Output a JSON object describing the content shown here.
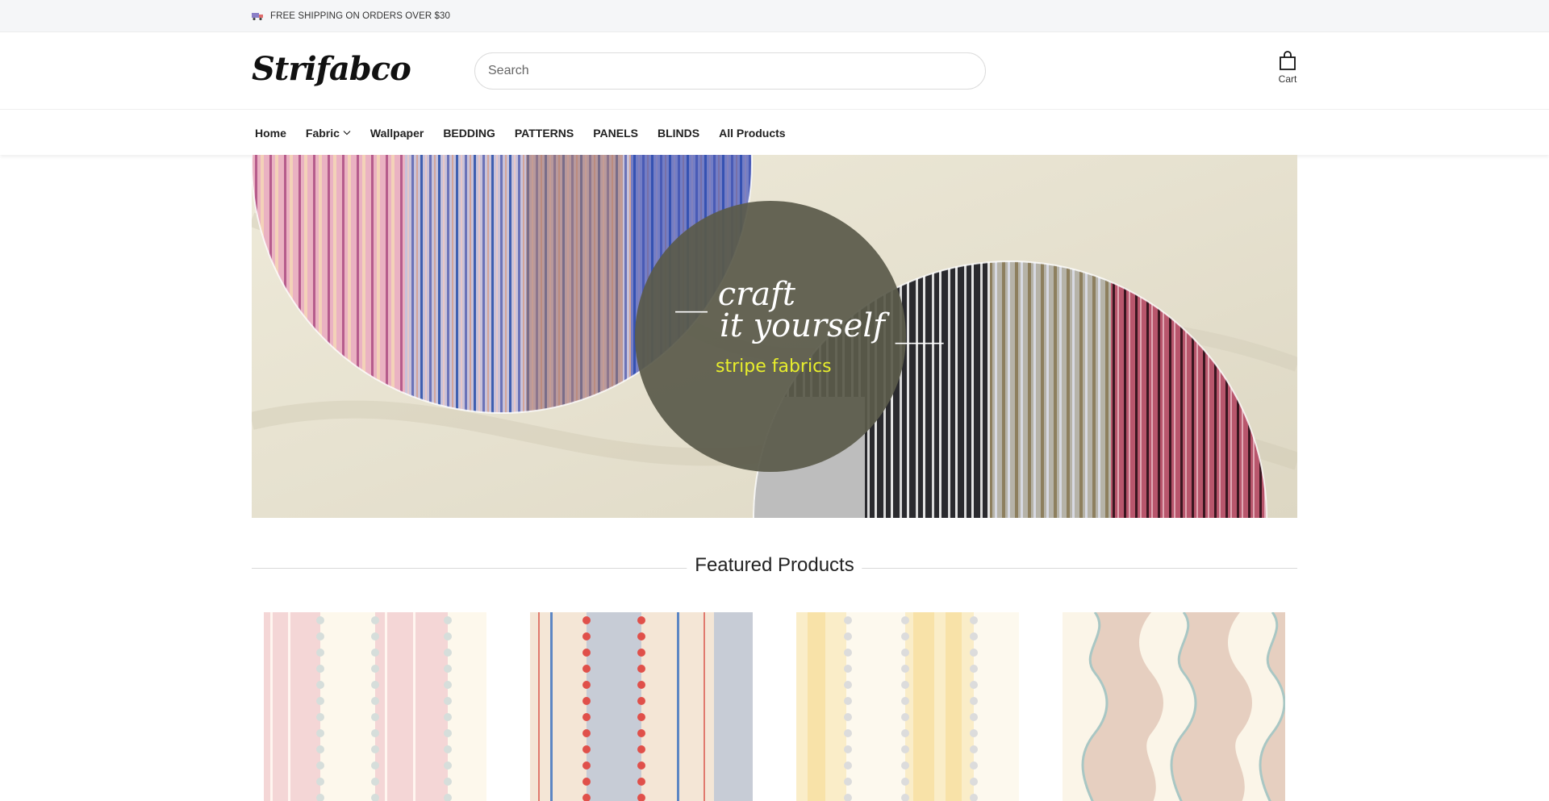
{
  "announcement": {
    "text": "FREE SHIPPING ON ORDERS OVER $30",
    "icon": "truck-icon"
  },
  "header": {
    "logo": "Strifabco",
    "search": {
      "placeholder": "Search",
      "value": ""
    },
    "cart": {
      "label": "Cart",
      "icon": "shopping-bag-icon"
    }
  },
  "nav": {
    "items": [
      {
        "label": "Home"
      },
      {
        "label": "Fabric",
        "has_dropdown": true
      },
      {
        "label": "Wallpaper"
      },
      {
        "label": "BEDDING"
      },
      {
        "label": "PATTERNS"
      },
      {
        "label": "PANELS"
      },
      {
        "label": "BLINDS"
      },
      {
        "label": "All Products"
      }
    ]
  },
  "hero": {
    "line1": "__ craft",
    "line2": "it  yourself ___",
    "subtitle": "stripe fabrics"
  },
  "featured": {
    "title": "Featured Products"
  },
  "colors": {
    "hero_circle": "#5a5a4a",
    "hero_background": "#e8e3d2",
    "hero_subtitle": "#e8ee2c",
    "topbar": "#f5f6f8"
  }
}
